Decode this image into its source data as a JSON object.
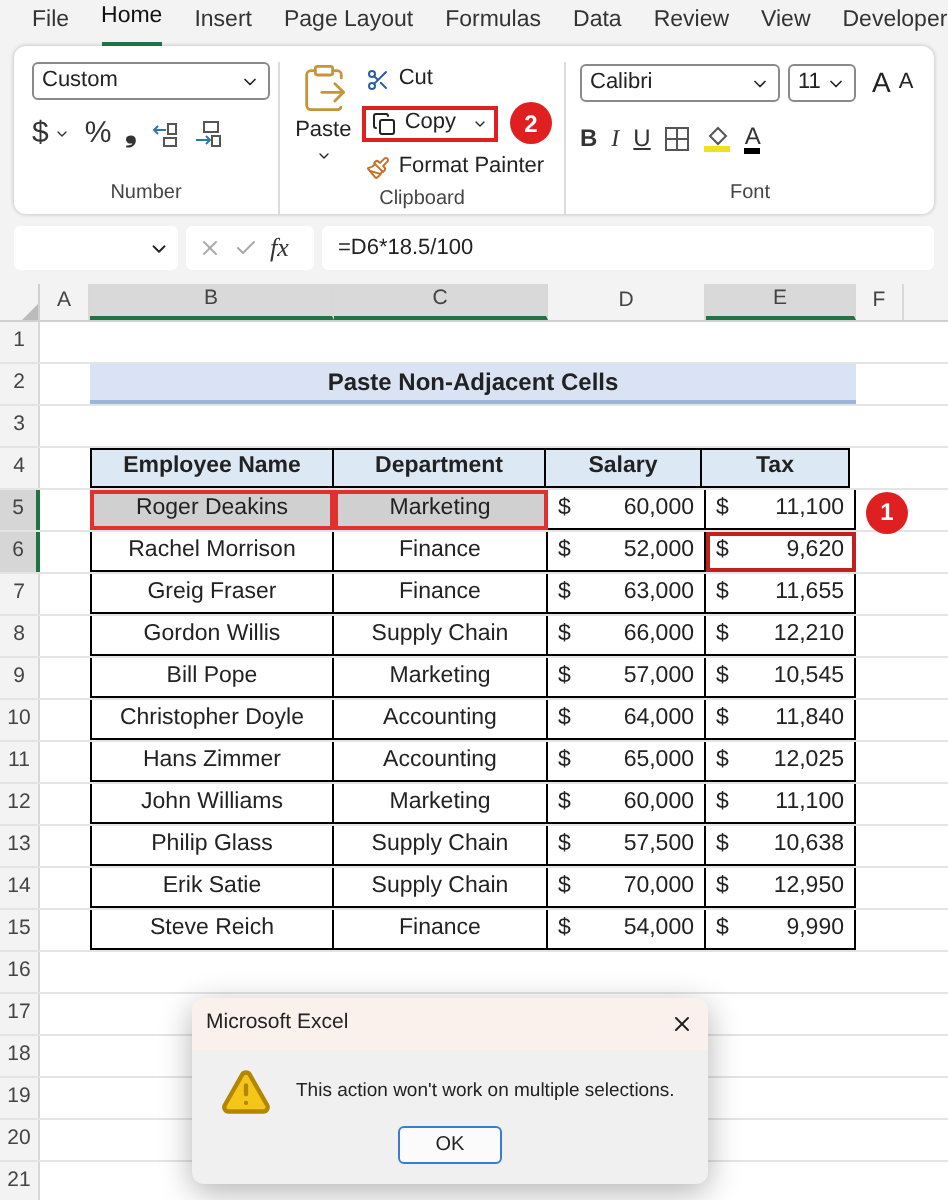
{
  "menu_tabs": [
    {
      "label": "File",
      "selected": false
    },
    {
      "label": "Home",
      "selected": true
    },
    {
      "label": "Insert",
      "selected": false
    },
    {
      "label": "Page Layout",
      "selected": false
    },
    {
      "label": "Formulas",
      "selected": false
    },
    {
      "label": "Data",
      "selected": false
    },
    {
      "label": "Review",
      "selected": false
    },
    {
      "label": "View",
      "selected": false
    },
    {
      "label": "Developer",
      "selected": false
    }
  ],
  "ribbon": {
    "number": {
      "format": "Custom",
      "symbols": [
        "$",
        "%",
        "❟"
      ],
      "label": "Number"
    },
    "clipboard": {
      "paste": "Paste",
      "cut": "Cut",
      "copy": "Copy",
      "copy_callout": "2",
      "format_painter": "Format Painter",
      "label": "Clipboard"
    },
    "font": {
      "family": "Calibri",
      "size": "11",
      "grow": "A",
      "shrink": "A",
      "bold": "B",
      "italic": "I",
      "underline": "U",
      "font_color": "A",
      "label": "Font"
    }
  },
  "formula_bar": {
    "fx": "fx",
    "formula": "=D6*18.5/100"
  },
  "columns": [
    {
      "label": "A",
      "selected": false
    },
    {
      "label": "B",
      "selected": true
    },
    {
      "label": "C",
      "selected": true
    },
    {
      "label": "D",
      "selected": false
    },
    {
      "label": "E",
      "selected": true
    },
    {
      "label": "F",
      "selected": false
    }
  ],
  "row_headers": [
    {
      "label": "1",
      "selected": false
    },
    {
      "label": "2",
      "selected": false
    },
    {
      "label": "3",
      "selected": false
    },
    {
      "label": "4",
      "selected": false
    },
    {
      "label": "5",
      "selected": true
    },
    {
      "label": "6",
      "selected": true
    },
    {
      "label": "7",
      "selected": false
    },
    {
      "label": "8",
      "selected": false
    },
    {
      "label": "9",
      "selected": false
    },
    {
      "label": "10",
      "selected": false
    },
    {
      "label": "11",
      "selected": false
    },
    {
      "label": "12",
      "selected": false
    },
    {
      "label": "13",
      "selected": false
    },
    {
      "label": "14",
      "selected": false
    },
    {
      "label": "15",
      "selected": false
    },
    {
      "label": "16",
      "selected": false
    },
    {
      "label": "17",
      "selected": false
    },
    {
      "label": "18",
      "selected": false
    },
    {
      "label": "19",
      "selected": false
    },
    {
      "label": "20",
      "selected": false
    },
    {
      "label": "21",
      "selected": false
    }
  ],
  "sheet_title": "Paste Non-Adjacent Cells",
  "table": {
    "columns": [
      "Employee Name",
      "Department",
      "Salary",
      "Tax"
    ],
    "rows": [
      {
        "name": "Roger Deakins",
        "department": "Marketing",
        "salary_symbol": "$",
        "salary": "60,000",
        "tax_symbol": "$",
        "tax": "11,100",
        "name_selected": true,
        "tax_selected": false,
        "callout": "1"
      },
      {
        "name": "Rachel Morrison",
        "department": "Finance",
        "salary_symbol": "$",
        "salary": "52,000",
        "tax_symbol": "$",
        "tax": "9,620",
        "name_selected": false,
        "tax_selected": true
      },
      {
        "name": "Greig Fraser",
        "department": "Finance",
        "salary_symbol": "$",
        "salary": "63,000",
        "tax_symbol": "$",
        "tax": "11,655",
        "name_selected": false,
        "tax_selected": false
      },
      {
        "name": "Gordon Willis",
        "department": "Supply Chain",
        "salary_symbol": "$",
        "salary": "66,000",
        "tax_symbol": "$",
        "tax": "12,210",
        "name_selected": false,
        "tax_selected": false
      },
      {
        "name": "Bill Pope",
        "department": "Marketing",
        "salary_symbol": "$",
        "salary": "57,000",
        "tax_symbol": "$",
        "tax": "10,545",
        "name_selected": false,
        "tax_selected": false
      },
      {
        "name": "Christopher Doyle",
        "department": "Accounting",
        "salary_symbol": "$",
        "salary": "64,000",
        "tax_symbol": "$",
        "tax": "11,840",
        "name_selected": false,
        "tax_selected": false
      },
      {
        "name": "Hans Zimmer",
        "department": "Accounting",
        "salary_symbol": "$",
        "salary": "65,000",
        "tax_symbol": "$",
        "tax": "12,025",
        "name_selected": false,
        "tax_selected": false
      },
      {
        "name": "John Williams",
        "department": "Marketing",
        "salary_symbol": "$",
        "salary": "60,000",
        "tax_symbol": "$",
        "tax": "11,100",
        "name_selected": false,
        "tax_selected": false
      },
      {
        "name": "Philip Glass",
        "department": "Supply Chain",
        "salary_symbol": "$",
        "salary": "57,500",
        "tax_symbol": "$",
        "tax": "10,638",
        "name_selected": false,
        "tax_selected": false
      },
      {
        "name": "Erik Satie",
        "department": "Supply Chain",
        "salary_symbol": "$",
        "salary": "70,000",
        "tax_symbol": "$",
        "tax": "12,950",
        "name_selected": false,
        "tax_selected": false
      },
      {
        "name": "Steve Reich",
        "department": "Finance",
        "salary_symbol": "$",
        "salary": "54,000",
        "tax_symbol": "$",
        "tax": "9,990",
        "name_selected": false,
        "tax_selected": false
      }
    ]
  },
  "dialog": {
    "title": "Microsoft Excel",
    "message": "This action won't work on multiple selections.",
    "button": "OK"
  }
}
